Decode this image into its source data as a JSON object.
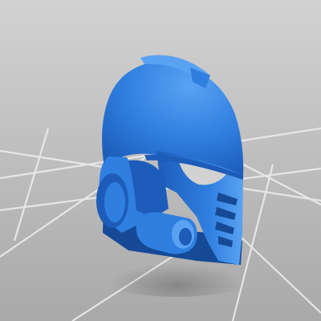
{
  "scene": {
    "subject": "helmet-model",
    "colors": {
      "background_top": "#d2d2d2",
      "background_bottom": "#a9a9a9",
      "grid_line": "#ececec",
      "model_base": "#2f7fe0",
      "model_light": "#5aa2f2",
      "model_shadow": "#1d5cb8",
      "model_deep": "#164a96"
    }
  }
}
